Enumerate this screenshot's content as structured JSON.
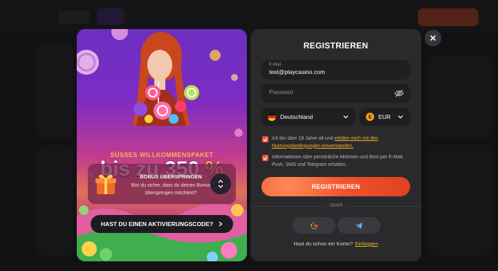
{
  "promo": {
    "subtitle": "SÜSSES WILLKOMMENSPAKET",
    "title_main": "bis zu 350 ",
    "title_pct": "%",
    "bonus": {
      "title": "BONUS ÜBERSPRINGEN",
      "text": "Bist du sicher, dass du deinen Bonus überspringen möchtest?"
    },
    "code_button": "HAST DU EINEN AKTIVIERUNGSCODE?"
  },
  "form": {
    "title": "REGISTRIEREN",
    "email_label": "E-Mail",
    "email_value": "test@playcasino.com",
    "password_placeholder": "Passwort",
    "country": "Deutschland",
    "currency": "EUR",
    "terms_text": "Ich bin über 18 Jahre alt und ",
    "terms_link": "erkläre mich mit den Nutzungsbedingungen einverstanden.",
    "marketing_text": "Informationen über persönliche Aktionen und Boni per E-Mail, Push, SMS und Telegram erhalten.",
    "submit": "REGISTRIEREN",
    "divider": "ODER",
    "login_prompt": "Hast du schon ein Konto?",
    "login_link": "Einloggen",
    "terms_checked": true,
    "marketing_checked": true
  },
  "icons": {
    "close": "close-icon",
    "eye": "eye-off-icon",
    "google": "google-icon",
    "telegram": "telegram-icon",
    "gift": "gift-icon",
    "toggle": "chevron-up-down-icon",
    "arrow": "chevron-right-icon"
  },
  "colors": {
    "accent": "#f0542e",
    "link": "#f0b429",
    "panel": "#2a2a2c",
    "field": "#1f1f21"
  }
}
